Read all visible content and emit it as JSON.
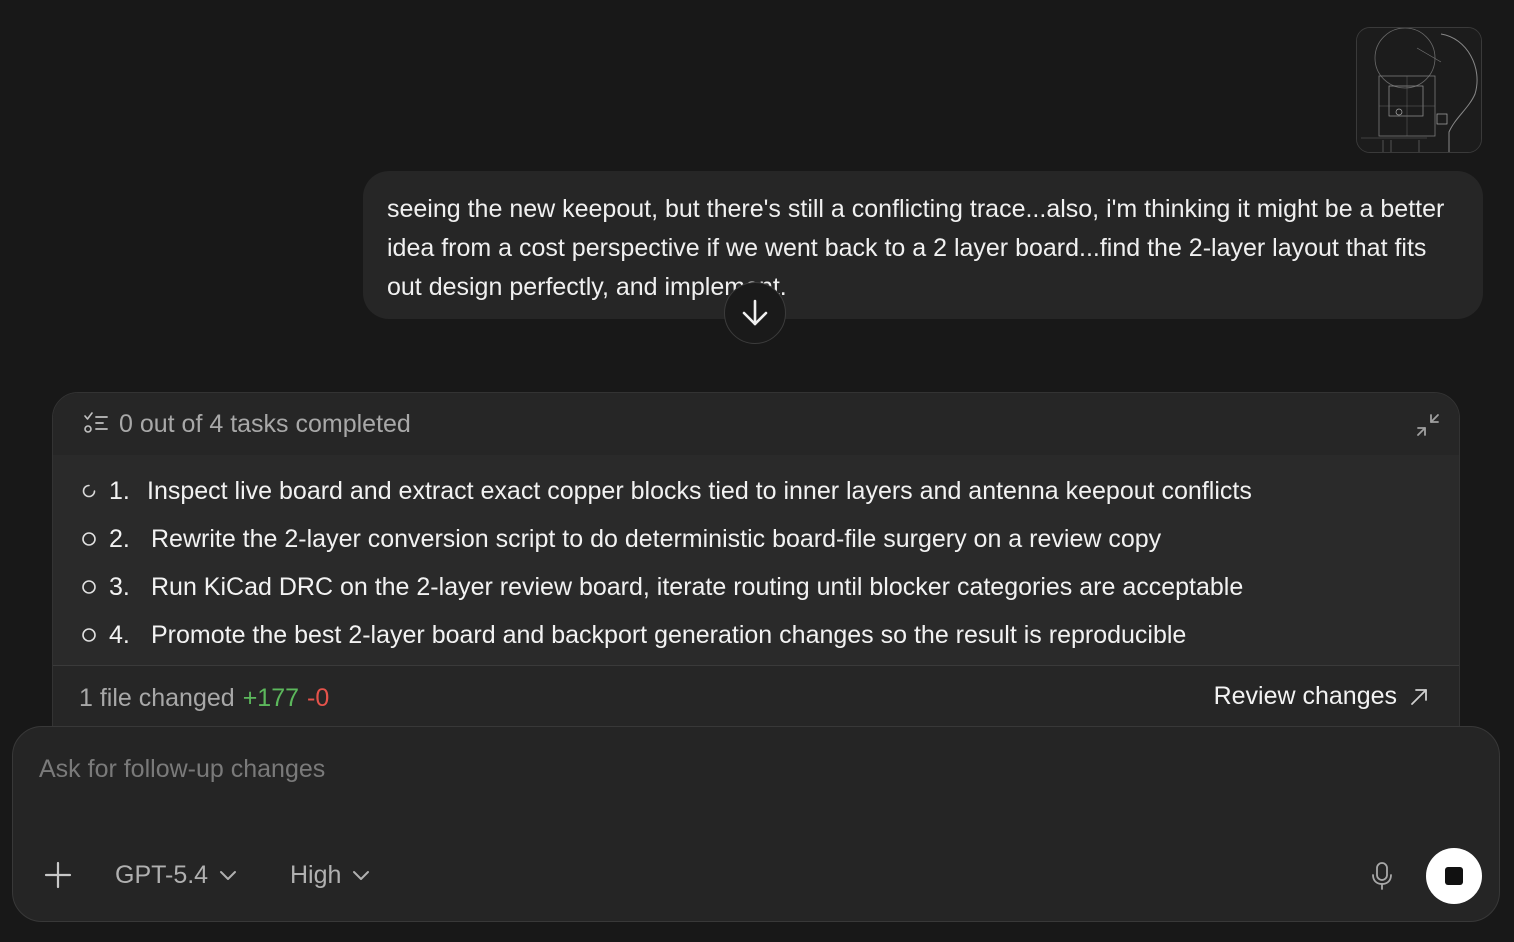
{
  "attachment": {
    "icon": "image-thumbnail"
  },
  "user_message": {
    "text": "seeing the new keepout, but there's still a conflicting trace...also, i'm thinking it might be a better idea from a cost perspective if we went back to a 2 layer board...find the 2-layer layout that fits out design perfectly, and implement."
  },
  "scroll_button": {
    "icon": "arrow-down-icon"
  },
  "tasks": {
    "summary": "0 out of 4 tasks completed",
    "items": [
      {
        "number": "1.",
        "text": "Inspect live board and extract exact copper blocks tied to inner layers and antenna keepout conflicts",
        "status": "in-progress"
      },
      {
        "number": "2.",
        "text": "Rewrite the 2-layer conversion script to do deterministic board-file surgery on a review copy",
        "status": "pending"
      },
      {
        "number": "3.",
        "text": "Run KiCad DRC on the 2-layer review board, iterate routing until blocker categories are acceptable",
        "status": "pending"
      },
      {
        "number": "4.",
        "text": "Promote the best 2-layer board and backport generation changes so the result is reproducible",
        "status": "pending"
      }
    ],
    "footer": {
      "files_changed": "1 file changed",
      "additions": "+177",
      "deletions": "-0",
      "review_label": "Review changes"
    }
  },
  "composer": {
    "placeholder": "Ask for follow-up changes",
    "model": "GPT-5.4",
    "effort": "High"
  },
  "colors": {
    "background": "#181818",
    "addition": "#5cb85c",
    "deletion": "#e5534b"
  }
}
